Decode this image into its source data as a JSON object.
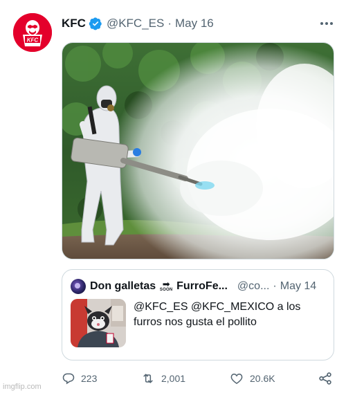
{
  "tweet": {
    "author_name": "KFC",
    "handle": "@KFC_ES",
    "separator": "·",
    "date": "May 16",
    "avatar_logo_text": "KFC",
    "media_icon": "fogging-photo"
  },
  "quote": {
    "author_name": "Don galletas",
    "soon_arrow": "➡",
    "soon_label": "SOON",
    "author_name_2": "FurroFe...",
    "handle": "@co...",
    "separator": "·",
    "date": "May 14",
    "text": "@KFC_ES @KFC_MEXICO a los furros nos gusta el pollito"
  },
  "actions": {
    "replies": "223",
    "retweets": "2,001",
    "likes": "20.6K"
  },
  "watermark": "imgflip.com",
  "colors": {
    "kfc_red": "#e4002b",
    "verified_blue": "#1d9bf0",
    "secondary_text": "#536471",
    "border": "#cfd9de"
  }
}
